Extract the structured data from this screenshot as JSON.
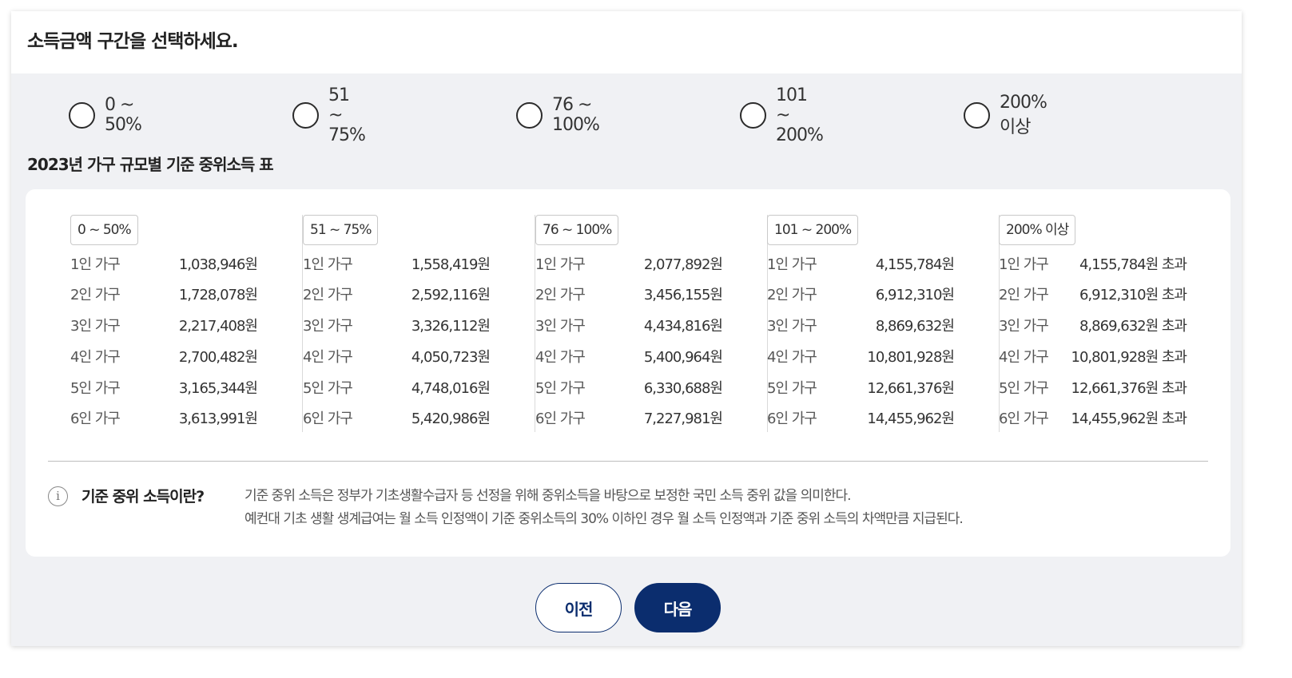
{
  "header": {
    "title": "소득금액 구간을 선택하세요."
  },
  "options": [
    {
      "label": "0 ~ 50%",
      "selected": false
    },
    {
      "label": "51 ~ 75%",
      "selected": false
    },
    {
      "label": "76 ~ 100%",
      "selected": false
    },
    {
      "label": "101 ~ 200%",
      "selected": false
    },
    {
      "label": "200% 이상",
      "selected": false
    }
  ],
  "table": {
    "title": "2023년 가구 규모별 기준 중위소득 표",
    "columns": [
      {
        "tag": "0 ~ 50%",
        "rows": [
          {
            "household": "1인 가구",
            "amount": "1,038,946원"
          },
          {
            "household": "2인 가구",
            "amount": "1,728,078원"
          },
          {
            "household": "3인 가구",
            "amount": "2,217,408원"
          },
          {
            "household": "4인 가구",
            "amount": "2,700,482원"
          },
          {
            "household": "5인 가구",
            "amount": "3,165,344원"
          },
          {
            "household": "6인 가구",
            "amount": "3,613,991원"
          }
        ]
      },
      {
        "tag": "51 ~ 75%",
        "rows": [
          {
            "household": "1인 가구",
            "amount": "1,558,419원"
          },
          {
            "household": "2인 가구",
            "amount": "2,592,116원"
          },
          {
            "household": "3인 가구",
            "amount": "3,326,112원"
          },
          {
            "household": "4인 가구",
            "amount": "4,050,723원"
          },
          {
            "household": "5인 가구",
            "amount": "4,748,016원"
          },
          {
            "household": "6인 가구",
            "amount": "5,420,986원"
          }
        ]
      },
      {
        "tag": "76 ~ 100%",
        "rows": [
          {
            "household": "1인 가구",
            "amount": "2,077,892원"
          },
          {
            "household": "2인 가구",
            "amount": "3,456,155원"
          },
          {
            "household": "3인 가구",
            "amount": "4,434,816원"
          },
          {
            "household": "4인 가구",
            "amount": "5,400,964원"
          },
          {
            "household": "5인 가구",
            "amount": "6,330,688원"
          },
          {
            "household": "6인 가구",
            "amount": "7,227,981원"
          }
        ]
      },
      {
        "tag": "101 ~ 200%",
        "rows": [
          {
            "household": "1인 가구",
            "amount": "4,155,784원"
          },
          {
            "household": "2인 가구",
            "amount": "6,912,310원"
          },
          {
            "household": "3인 가구",
            "amount": "8,869,632원"
          },
          {
            "household": "4인 가구",
            "amount": "10,801,928원"
          },
          {
            "household": "5인 가구",
            "amount": "12,661,376원"
          },
          {
            "household": "6인 가구",
            "amount": "14,455,962원"
          }
        ]
      },
      {
        "tag": "200% 이상",
        "rows": [
          {
            "household": "1인 가구",
            "amount": "4,155,784원 초과"
          },
          {
            "household": "2인 가구",
            "amount": "6,912,310원 초과"
          },
          {
            "household": "3인 가구",
            "amount": "8,869,632원 초과"
          },
          {
            "household": "4인 가구",
            "amount": "10,801,928원 초과"
          },
          {
            "household": "5인 가구",
            "amount": "12,661,376원 초과"
          },
          {
            "household": "6인 가구",
            "amount": "14,455,962원 초과"
          }
        ]
      }
    ]
  },
  "info": {
    "icon": "info-icon",
    "icon_glyph": "i",
    "title": "기준 중위 소득이란?",
    "line1": "기준 중위 소득은 정부가 기초생활수급자 등 선정을 위해 중위소득을 바탕으로 보정한 국민 소득 중위 값을 의미한다.",
    "line2": "예컨대 기초 생활 생계급여는 월 소득 인정액이 기준 중위소득의 30% 이하인 경우 월 소득 인정액과 기준 중위 소득의 차액만큼 지급된다."
  },
  "buttons": {
    "prev_label": "이전",
    "next_label": "다음"
  },
  "colors": {
    "primary": "#0b2d6e",
    "background": "#f0f1f4"
  }
}
